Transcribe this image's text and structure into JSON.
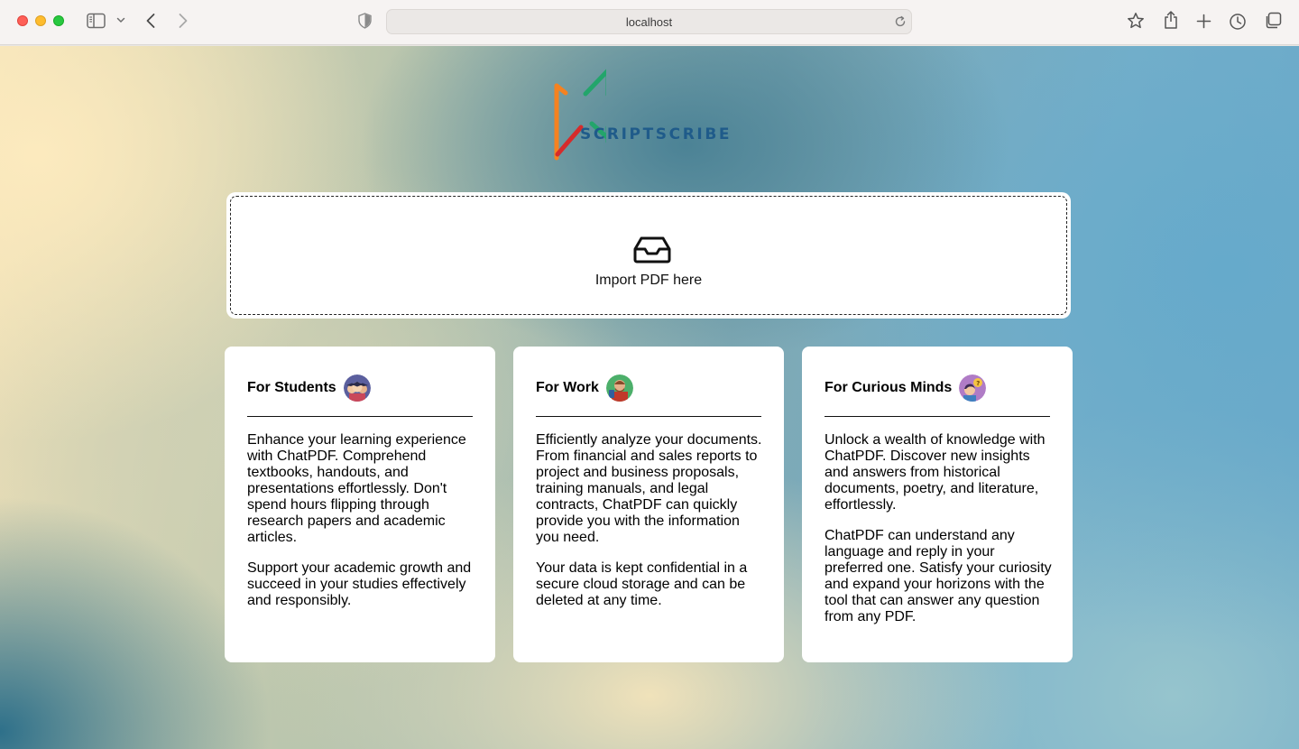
{
  "browser": {
    "url": "localhost",
    "icons": [
      "sidebar-icon",
      "chevron-down-icon",
      "back-icon",
      "forward-icon",
      "shield-icon",
      "reload-icon",
      "star-icon",
      "share-icon",
      "plus-icon",
      "history-icon",
      "tabs-icon"
    ]
  },
  "logo": {
    "text": "SCRIPTSCRIBE",
    "colors": [
      "#f58220",
      "#d62b2b",
      "#23a56b",
      "#1f5b8a"
    ]
  },
  "import": {
    "label": "Import PDF here",
    "icon": "inbox-icon"
  },
  "cards": [
    {
      "title": "For Students",
      "avatar_icon": "students-avatar-icon",
      "paragraphs": [
        "Enhance your learning experience with ChatPDF. Comprehend textbooks, handouts, and presentations effortlessly. Don't spend hours flipping through research papers and academic articles.",
        "Support your academic growth and succeed in your studies effectively and responsibly."
      ]
    },
    {
      "title": "For Work",
      "avatar_icon": "worker-avatar-icon",
      "paragraphs": [
        "Efficiently analyze your documents. From financial and sales reports to project and business proposals, training manuals, and legal contracts, ChatPDF can quickly provide you with the information you need.",
        "Your data is kept confidential in a secure cloud storage and can be deleted at any time."
      ]
    },
    {
      "title": "For Curious Minds",
      "avatar_icon": "curious-avatar-icon",
      "paragraphs": [
        "Unlock a wealth of knowledge with ChatPDF. Discover new insights and answers from historical documents, poetry, and literature, effortlessly.",
        "ChatPDF can understand any language and reply in your preferred one. Satisfy your curiosity and expand your horizons with the tool that can answer any question from any PDF."
      ]
    }
  ]
}
